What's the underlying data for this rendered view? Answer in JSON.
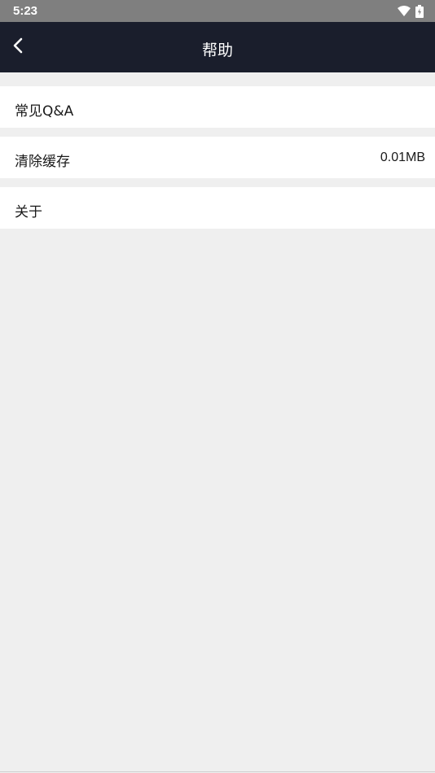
{
  "status_bar": {
    "time": "5:23",
    "icons": [
      "wifi-icon",
      "battery-charging-icon"
    ]
  },
  "app_bar": {
    "back_icon": "chevron-left-icon",
    "title": "帮助"
  },
  "menu": {
    "items": [
      {
        "label": "常见Q&A",
        "value": ""
      },
      {
        "label": "清除缓存",
        "value": "0.01MB"
      },
      {
        "label": "关于",
        "value": ""
      }
    ]
  },
  "colors": {
    "status_bar_bg": "#7f7f7f",
    "app_bar_bg": "#1a1e2c",
    "page_bg": "#efefef",
    "item_bg": "#ffffff"
  }
}
